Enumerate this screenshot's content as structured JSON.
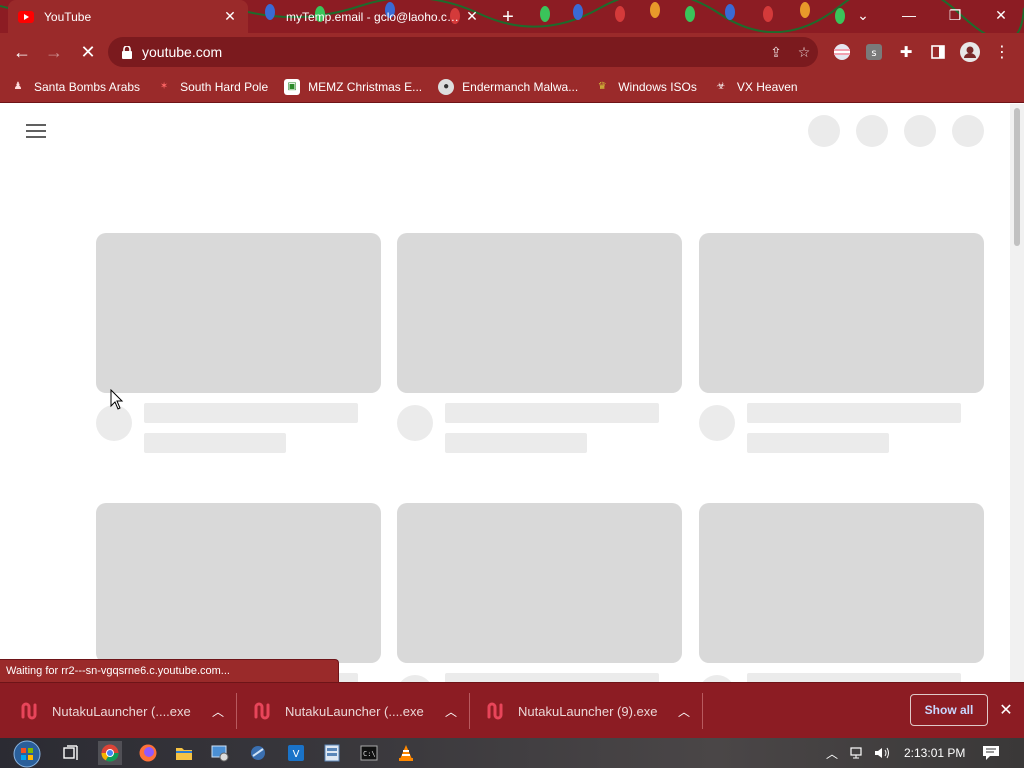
{
  "tabs": [
    {
      "title": "YouTube",
      "active": true
    },
    {
      "title": "myTemp.email - gclo@laoho.com",
      "active": false
    }
  ],
  "toolbar": {
    "url": "youtube.com"
  },
  "bookmarks": [
    {
      "label": "Santa Bombs Arabs",
      "icon": "santa-icon"
    },
    {
      "label": "South Hard Pole",
      "icon": "star-icon"
    },
    {
      "label": "MEMZ Christmas E...",
      "icon": "memz-icon"
    },
    {
      "label": "Endermanch Malwa...",
      "icon": "raccoon-icon"
    },
    {
      "label": "Windows ISOs",
      "icon": "trophy-icon"
    },
    {
      "label": "VX Heaven",
      "icon": "biohazard-icon"
    }
  ],
  "status": {
    "text": "Waiting for rr2---sn-vgqsrne6.c.youtube.com..."
  },
  "downloads": {
    "items": [
      {
        "name": "NutakuLauncher (....exe"
      },
      {
        "name": "NutakuLauncher (....exe"
      },
      {
        "name": "NutakuLauncher (9).exe"
      }
    ],
    "show_all_label": "Show all"
  },
  "taskbar": {
    "clock": "2:13:01 PM"
  },
  "colors": {
    "chrome_theme": "#9a2a2a",
    "skeleton_thumbnail": "#d9d9d9",
    "skeleton_text": "#ebebeb",
    "show_all_text": "#c8d8ff"
  }
}
